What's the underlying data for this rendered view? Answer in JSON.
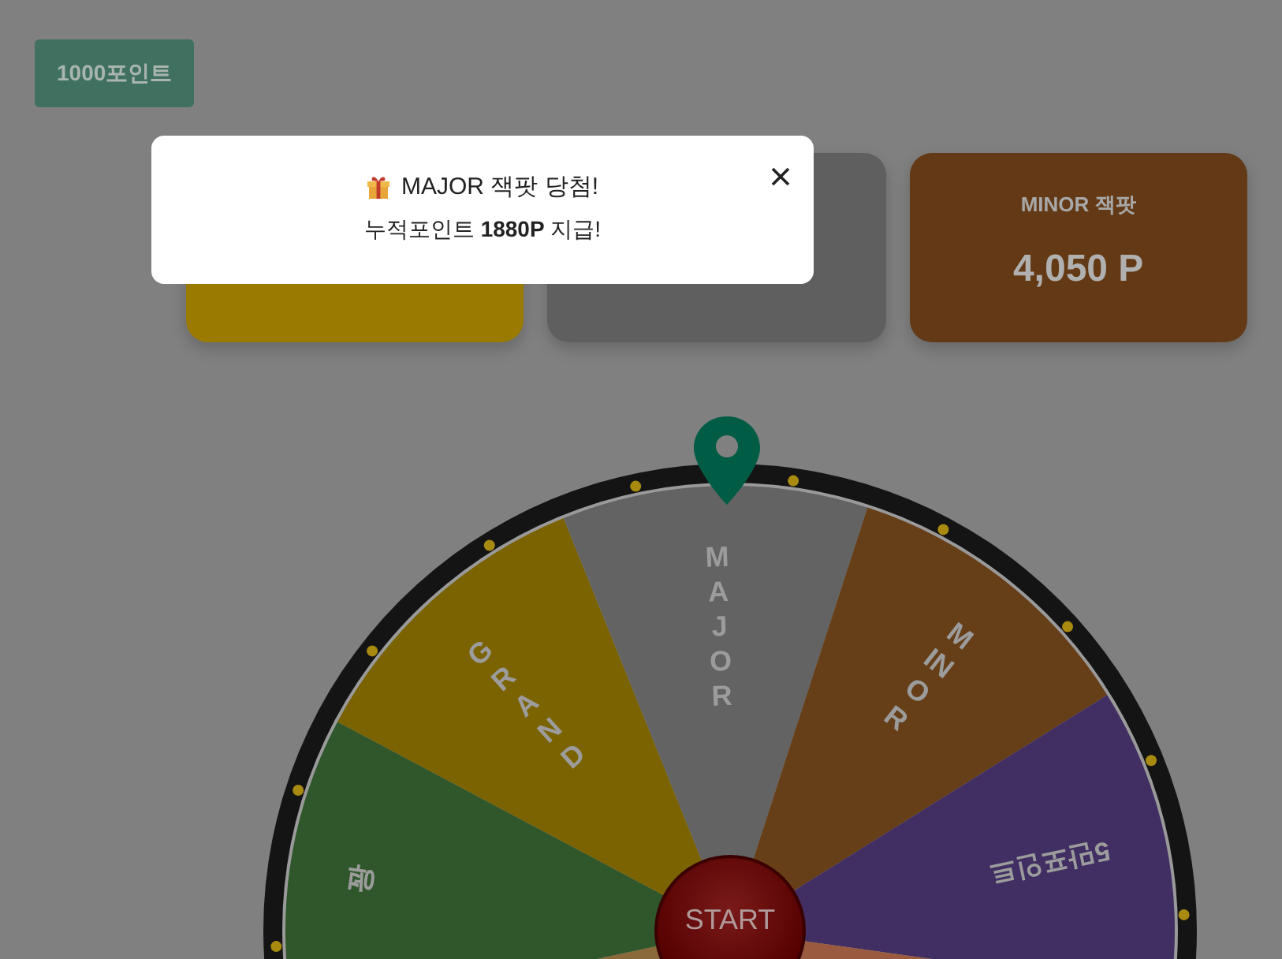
{
  "points_button": "1000포인트",
  "jackpots": [
    {
      "color": "#9a7b00"
    },
    {
      "color": "#5f5f5f"
    },
    {
      "title": "MINOR 잭팟",
      "value": "4,050 P",
      "color": "#633a15"
    }
  ],
  "wheel": {
    "segments": [
      {
        "color": "#8a6a3a"
      },
      {
        "label": "꽝",
        "color": "#30572c",
        "kind": "stacked"
      },
      {
        "label": "GRAND",
        "color": "#7a6300",
        "kind": "stacked"
      },
      {
        "label": "MAJOR",
        "color": "#636363",
        "kind": "stacked"
      },
      {
        "label": "MINOR",
        "color": "#663f19",
        "kind": "stacked"
      },
      {
        "label": "5만포인트",
        "color": "#412e63",
        "kind": "radial"
      },
      {
        "color": "#9a5a40"
      }
    ],
    "start_button": "START"
  },
  "modal": {
    "title": "MAJOR 잭팟 당첨!",
    "message": "누적포인트 **1880P** 지급!"
  }
}
